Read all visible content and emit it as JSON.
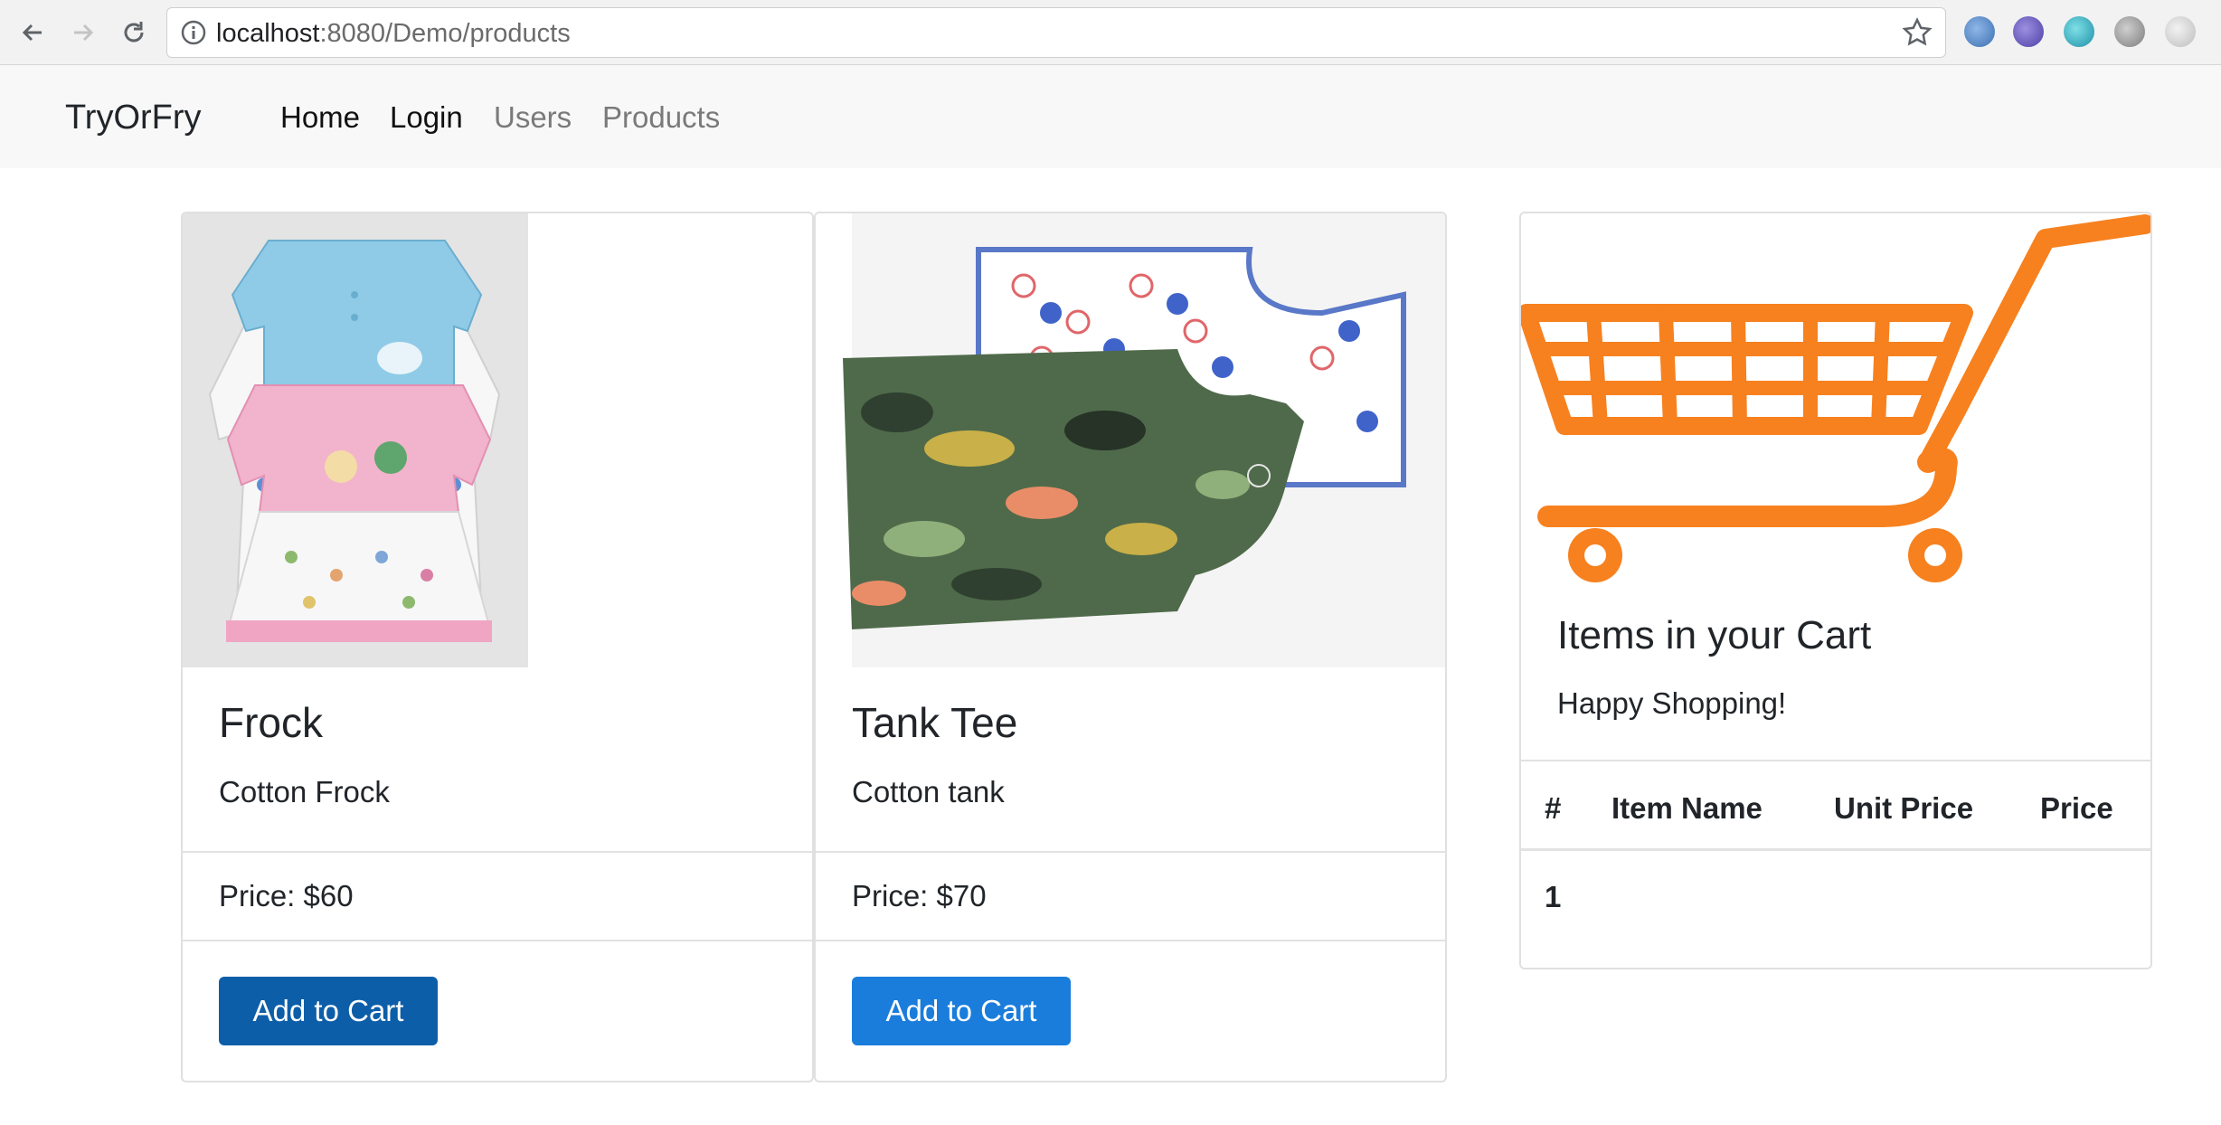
{
  "browser": {
    "url_host": "localhost",
    "url_rest": ":8080/Demo/products"
  },
  "navbar": {
    "brand": "TryOrFry",
    "links": [
      {
        "label": "Home"
      },
      {
        "label": "Login"
      },
      {
        "label": "Users"
      },
      {
        "label": "Products"
      }
    ]
  },
  "products": [
    {
      "title": "Frock",
      "description": "Cotton Frock",
      "price": "Price: $60",
      "button": "Add to Cart"
    },
    {
      "title": "Tank Tee",
      "description": "Cotton tank",
      "price": "Price: $70",
      "button": "Add to Cart"
    }
  ],
  "cart": {
    "title": "Items in your Cart",
    "subtitle": "Happy Shopping!",
    "columns": [
      "#",
      "Item Name",
      "Unit Price",
      "Price"
    ],
    "rows": [
      {
        "num": "1",
        "name": "",
        "unit_price": "",
        "price": ""
      }
    ]
  },
  "colors": {
    "accent": "#1a7ddb",
    "accent_dark": "#0d5ea8",
    "cart_orange": "#f7811f"
  },
  "icons": [
    "back-arrow-icon",
    "forward-arrow-icon",
    "reload-icon",
    "info-icon",
    "bookmark-star-icon",
    "shopping-cart-icon"
  ]
}
